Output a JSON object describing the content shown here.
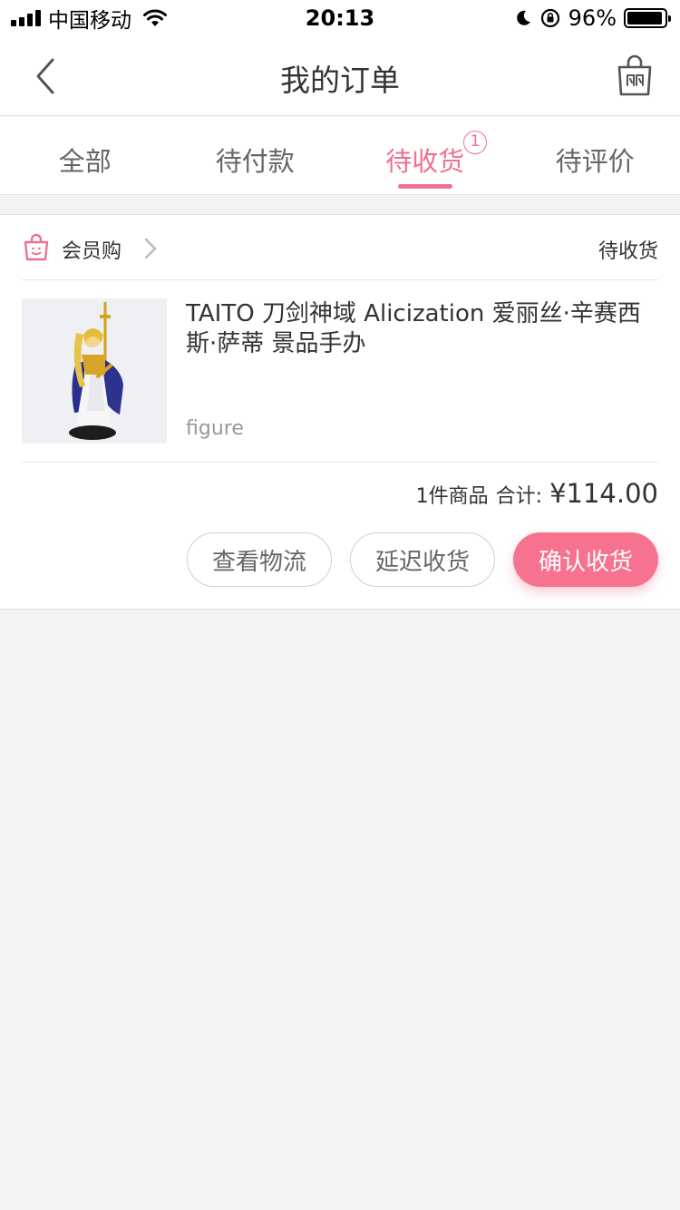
{
  "status_bar": {
    "carrier": "中国移动",
    "time": "20:13",
    "battery_text": "96%",
    "battery_level": 0.96
  },
  "nav": {
    "title": "我的订单",
    "back_icon": "chevron-left-icon",
    "cart_icon": "shopping-bag-icon"
  },
  "tabs": [
    {
      "label": "全部"
    },
    {
      "label": "待付款"
    },
    {
      "label": "待收货",
      "badge": "1",
      "active": true
    },
    {
      "label": "待评价"
    }
  ],
  "order": {
    "shop_name": "会员购",
    "status": "待收货",
    "product": {
      "title": "TAITO 刀剑神域 Alicization 爱丽丝·辛赛西斯·萨蒂 景品手办",
      "sku": "figure"
    },
    "summary": {
      "count": "1件商品",
      "total_label": "合计:",
      "total": "¥114.00"
    },
    "actions": {
      "logistics": "查看物流",
      "delay": "延迟收货",
      "confirm": "确认收货"
    }
  },
  "colors": {
    "accent": "#f07090",
    "primary_button": "#f7728f",
    "background": "#f3f3f3"
  }
}
